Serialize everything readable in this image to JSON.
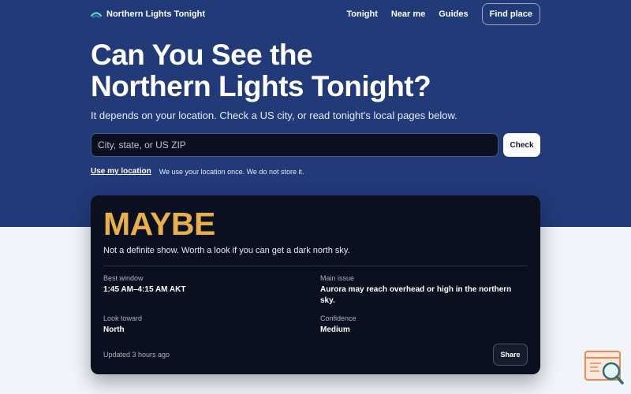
{
  "app": {
    "brand": "Northern Lights Tonight",
    "accent_color": "#e8b04a",
    "hero_color": "#223a78"
  },
  "nav": {
    "links": [
      "Tonight",
      "Near me",
      "Guides"
    ],
    "cta": "Find place"
  },
  "hero": {
    "title_line1": "Can You See the",
    "title_line2": "Northern Lights Tonight?",
    "subtitle": "It depends on your location. Check a US city, or read tonight's local pages below."
  },
  "search": {
    "placeholder": "City, state, or US ZIP",
    "value": "",
    "button": "Check"
  },
  "location": {
    "link": "Use my location",
    "note": "We use your location once. We do not store it."
  },
  "result": {
    "verdict": "MAYBE",
    "description": "Not a definite show. Worth a look if you can get a dark north sky.",
    "best_window_label": "Best window",
    "best_window": "1:45 AM–4:15 AM AKT",
    "main_issue_label": "Main issue",
    "main_issue": "Aurora may reach overhead or high in the northern sky.",
    "look_toward_label": "Look toward",
    "look_toward": "North",
    "confidence_label": "Confidence",
    "confidence": "Medium",
    "updated": "Updated 3 hours ago",
    "share": "Share"
  },
  "icons": {
    "brand": "aurora-logo-icon",
    "corner": "search-window-icon"
  }
}
